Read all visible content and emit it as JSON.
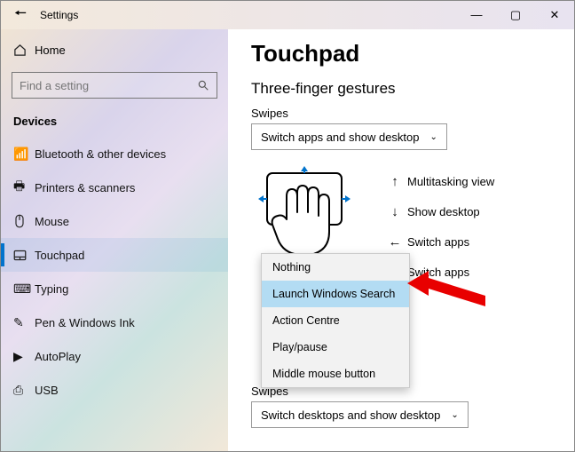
{
  "window": {
    "title": "Settings"
  },
  "sidebar": {
    "home": "Home",
    "search_placeholder": "Find a setting",
    "category": "Devices",
    "items": [
      {
        "label": "Bluetooth & other devices"
      },
      {
        "label": "Printers & scanners"
      },
      {
        "label": "Mouse"
      },
      {
        "label": "Touchpad"
      },
      {
        "label": "Typing"
      },
      {
        "label": "Pen & Windows Ink"
      },
      {
        "label": "AutoPlay"
      },
      {
        "label": "USB"
      }
    ]
  },
  "page": {
    "title": "Touchpad",
    "section": "Three-finger gestures",
    "swipes_label": "Swipes",
    "swipes_value": "Switch apps and show desktop",
    "gestures": {
      "up": "Multitasking view",
      "down": "Show desktop",
      "left": "Switch apps",
      "right": "Switch apps"
    },
    "swipes2_label": "Swipes",
    "swipes2_value": "Switch desktops and show desktop"
  },
  "menu": {
    "items": [
      "Nothing",
      "Launch Windows Search",
      "Action Centre",
      "Play/pause",
      "Middle mouse button"
    ],
    "selected_index": 1
  }
}
